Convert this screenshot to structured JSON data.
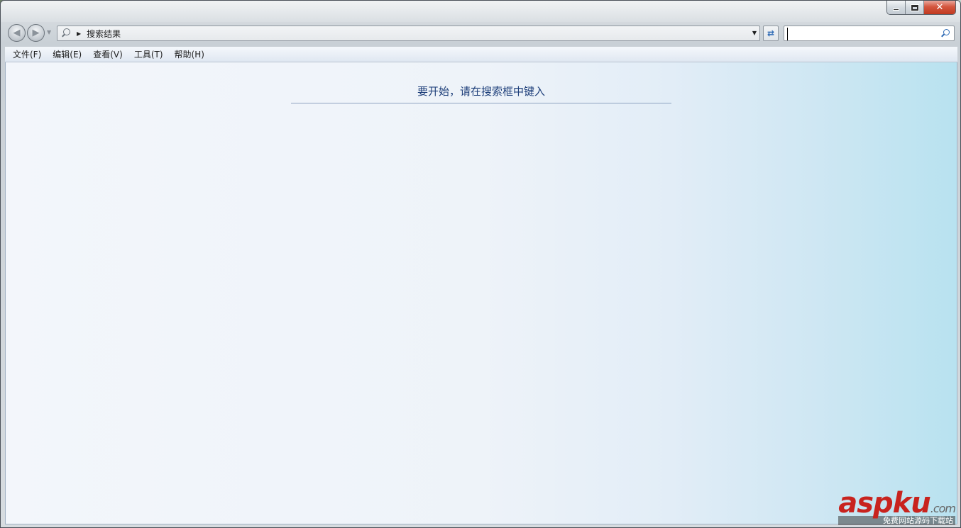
{
  "window": {
    "minimize_label": "",
    "maximize_label": "",
    "close_label": "✕"
  },
  "navbar": {
    "back_glyph": "◀",
    "forward_glyph": "▶",
    "address_arrow": "▶",
    "address_text": "搜索结果",
    "address_dropdown": "▼",
    "refresh_glyph": "⇄",
    "search_value": "",
    "search_placeholder": ""
  },
  "menubar": {
    "items": [
      {
        "label": "文件(F)"
      },
      {
        "label": "编辑(E)"
      },
      {
        "label": "查看(V)"
      },
      {
        "label": "工具(T)"
      },
      {
        "label": "帮助(H)"
      }
    ]
  },
  "content": {
    "hint": "要开始，请在搜索框中键入"
  },
  "watermark": {
    "logo_red": "asp",
    "logo_rest": "ku",
    "logo_suffix": ".com",
    "subtitle": "免费网站源码下载站"
  },
  "colors": {
    "accent": "#1e3f7a",
    "close_red": "#c0391f",
    "watermark_red": "#c8231e"
  }
}
